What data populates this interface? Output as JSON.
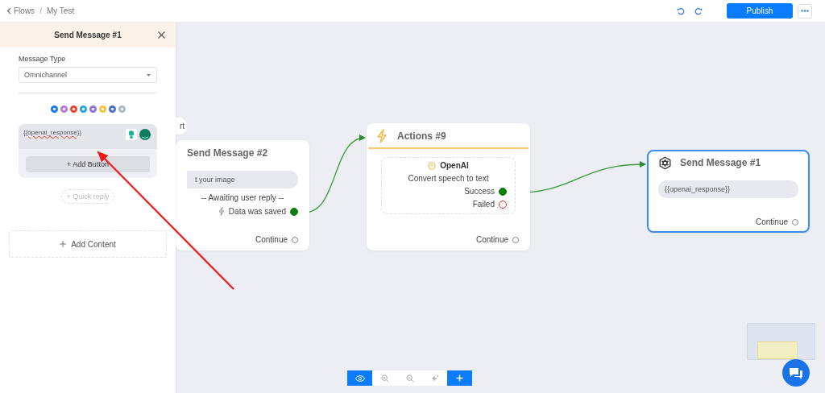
{
  "breadcrumb": {
    "back": "Flows",
    "separator": "/",
    "current": "My Test"
  },
  "publish_button": "Publish",
  "panel": {
    "title": "Send Message #1",
    "message_type_label": "Message Type",
    "message_type": "Omnichannel",
    "channels": [
      {
        "color": "#1877f2"
      },
      {
        "color": "#b57bd6"
      },
      {
        "color": "#ea4335"
      },
      {
        "color": "#2aa3de"
      },
      {
        "color": "#8f72d8"
      },
      {
        "color": "#f5c242"
      },
      {
        "color": "#4a6fc7"
      },
      {
        "color": "#b0b6c0"
      }
    ],
    "message_text": "{{openai_response}}",
    "add_button": "+ Add Button",
    "quick_reply": "+ Quick reply",
    "add_content": "Add Content"
  },
  "nodes": [
    {
      "kind": "start",
      "label": "rt"
    },
    {
      "kind": "message",
      "title": "Send Message #2",
      "selected": false,
      "bubble": "t your image",
      "status": "-- Awaiting user reply --",
      "outputs": [
        {
          "label": "Data was saved",
          "kind": "success"
        }
      ],
      "continue": "Continue"
    },
    {
      "kind": "action",
      "title": "Actions #9",
      "selected": false,
      "service": "OpenAI",
      "description": "Convert speech to text",
      "outputs": [
        {
          "label": "Success",
          "kind": "success"
        },
        {
          "label": "Failed",
          "kind": "failure"
        }
      ],
      "continue": "Continue"
    },
    {
      "kind": "message",
      "title": "Send Message #1",
      "selected": true,
      "bubble": "{{openai_response}}",
      "continue": "Continue"
    }
  ],
  "tools": [
    {
      "kind": "view",
      "selected": true
    },
    {
      "kind": "zoom_in",
      "selected": false
    },
    {
      "kind": "zoom_out",
      "selected": false
    },
    {
      "kind": "fit",
      "selected": false
    }
  ]
}
